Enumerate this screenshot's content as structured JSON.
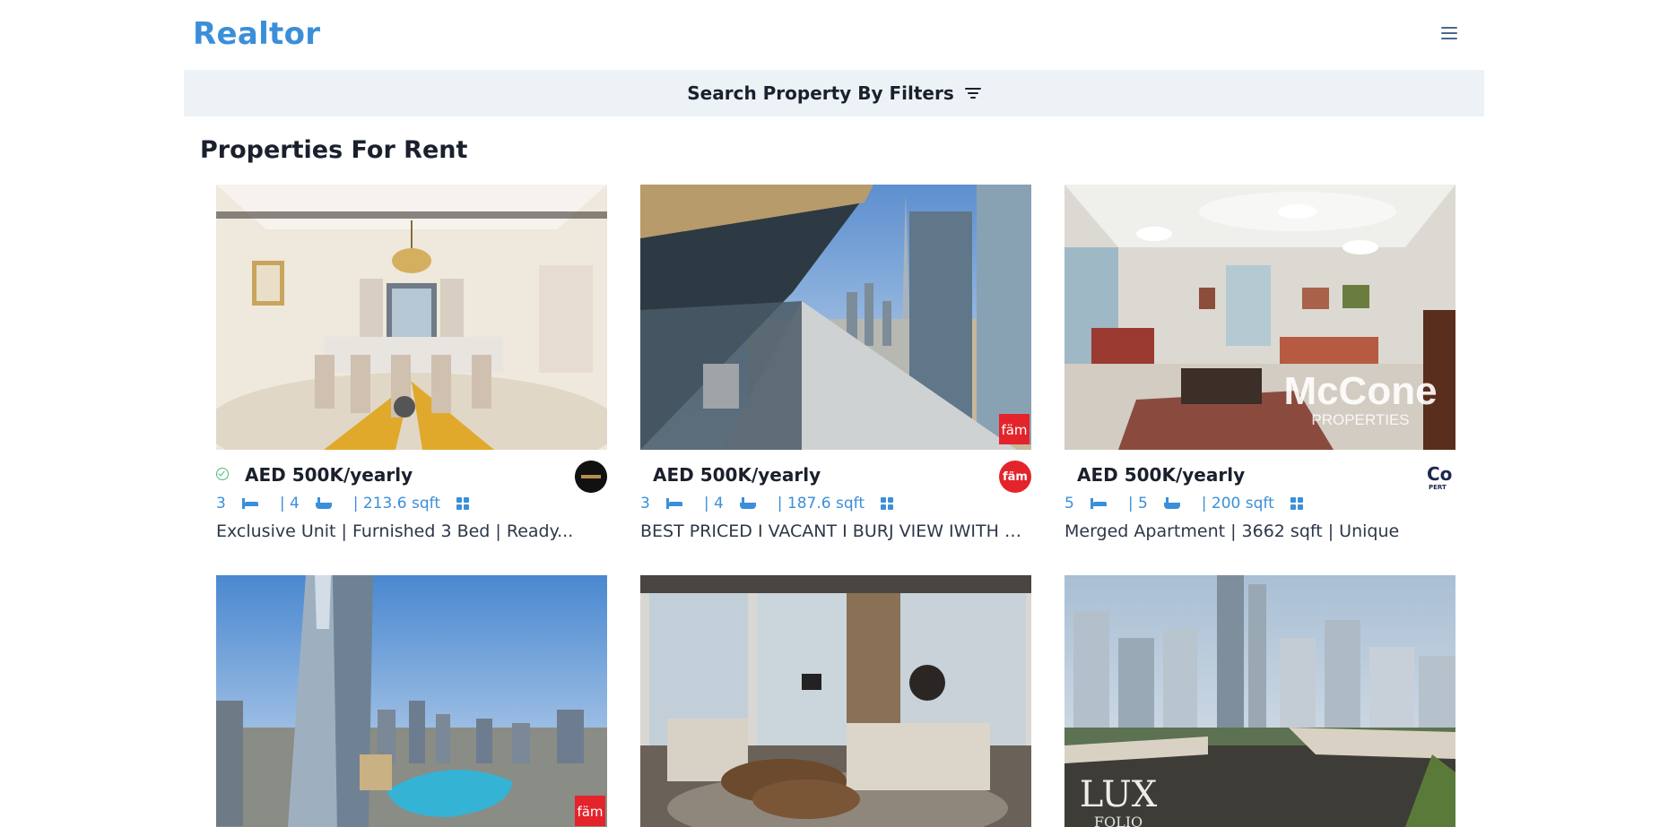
{
  "brand": {
    "logo": "Realtor"
  },
  "search": {
    "label": "Search Property By Filters"
  },
  "section": {
    "title": "Properties For Rent"
  },
  "listings": [
    {
      "price": "AED 500K/yearly",
      "verified": true,
      "rooms": "3",
      "baths": "| 4",
      "area": "| 213.6 sqft",
      "title": "Exclusive Unit | Furnished 3 Bed | Ready..."
    },
    {
      "price": "AED 500K/yearly",
      "verified": false,
      "rooms": "3",
      "baths": "| 4",
      "area": "| 187.6 sqft",
      "title": "BEST PRICED I VACANT I BURJ VIEW IWITH B..."
    },
    {
      "price": "AED 500K/yearly",
      "verified": false,
      "rooms": "5",
      "baths": "| 5",
      "area": "| 200 sqft",
      "title": "Merged Apartment | 3662 sqft | Unique"
    }
  ],
  "watermarks": {
    "fam": "fäm",
    "mccone_main": "McCone",
    "mccone_sub": "PROPERTIES",
    "co_main": "Co",
    "co_sub": "PERT",
    "lux_main": "LUX",
    "lux_sub": "FOLIO"
  },
  "colors": {
    "brand": "#3b8fd9",
    "search_bg": "#edf2f7",
    "verified": "#48bb78",
    "fam_red": "#e3242b"
  }
}
